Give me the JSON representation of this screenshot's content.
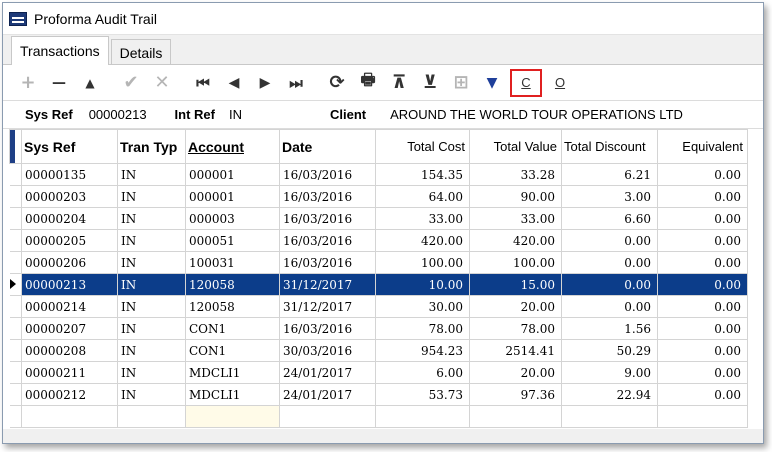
{
  "window": {
    "title": "Proforma Audit Trail"
  },
  "tabs": [
    {
      "label": "Transactions"
    },
    {
      "label": "Details"
    }
  ],
  "toolbar": {
    "buttons": [
      {
        "icon": "plus-icon",
        "glyph": "+"
      },
      {
        "icon": "minus-icon",
        "glyph": "—"
      },
      {
        "icon": "up-triangle-icon",
        "glyph": "▲"
      },
      {
        "icon": "checkmark-icon",
        "glyph": "✔"
      },
      {
        "icon": "cross-icon",
        "glyph": "✕"
      },
      {
        "icon": "first-record-icon",
        "glyph": "⏮"
      },
      {
        "icon": "prev-record-icon",
        "glyph": "◀"
      },
      {
        "icon": "next-record-icon",
        "glyph": "▶"
      },
      {
        "icon": "last-record-icon",
        "glyph": "⏭"
      },
      {
        "icon": "refresh-icon",
        "glyph": "⟳"
      },
      {
        "icon": "print-icon",
        "glyph": "🖶"
      },
      {
        "icon": "sort-top-icon",
        "glyph": "⊼"
      },
      {
        "icon": "sort-bottom-icon",
        "glyph": "⊻"
      },
      {
        "icon": "add-folder-icon",
        "glyph": "⊞"
      },
      {
        "icon": "filter-icon",
        "glyph": "▼"
      }
    ],
    "c_label": "C",
    "o_label": "O"
  },
  "info": {
    "sys_ref_label": "Sys Ref",
    "sys_ref_value": "00000213",
    "int_ref_label": "Int Ref",
    "int_ref_value": "IN",
    "client_label": "Client",
    "client_value": "AROUND THE WORLD TOUR OPERATIONS LTD"
  },
  "grid": {
    "headers": {
      "sys_ref": "Sys Ref",
      "tran_type": "Tran Typ",
      "account": "Account",
      "date": "Date",
      "total_cost": "Total Cost",
      "total_value": "Total Value",
      "total_discount": "Total Discount",
      "equivalent": "Equivalent"
    },
    "rows": [
      {
        "sys_ref": "00000135",
        "tran": "IN",
        "account": "000001",
        "date": "16/03/2016",
        "cost": "154.35",
        "value": "33.28",
        "discount": "6.21",
        "equiv": "0.00"
      },
      {
        "sys_ref": "00000203",
        "tran": "IN",
        "account": "000001",
        "date": "16/03/2016",
        "cost": "64.00",
        "value": "90.00",
        "discount": "3.00",
        "equiv": "0.00"
      },
      {
        "sys_ref": "00000204",
        "tran": "IN",
        "account": "000003",
        "date": "16/03/2016",
        "cost": "33.00",
        "value": "33.00",
        "discount": "6.60",
        "equiv": "0.00"
      },
      {
        "sys_ref": "00000205",
        "tran": "IN",
        "account": "000051",
        "date": "16/03/2016",
        "cost": "420.00",
        "value": "420.00",
        "discount": "0.00",
        "equiv": "0.00"
      },
      {
        "sys_ref": "00000206",
        "tran": "IN",
        "account": "100031",
        "date": "16/03/2016",
        "cost": "100.00",
        "value": "100.00",
        "discount": "0.00",
        "equiv": "0.00"
      },
      {
        "sys_ref": "00000213",
        "tran": "IN",
        "account": "120058",
        "date": "31/12/2017",
        "cost": "10.00",
        "value": "15.00",
        "discount": "0.00",
        "equiv": "0.00"
      },
      {
        "sys_ref": "00000214",
        "tran": "IN",
        "account": "120058",
        "date": "31/12/2017",
        "cost": "30.00",
        "value": "20.00",
        "discount": "0.00",
        "equiv": "0.00"
      },
      {
        "sys_ref": "00000207",
        "tran": "IN",
        "account": "CON1",
        "date": "16/03/2016",
        "cost": "78.00",
        "value": "78.00",
        "discount": "1.56",
        "equiv": "0.00"
      },
      {
        "sys_ref": "00000208",
        "tran": "IN",
        "account": "CON1",
        "date": "30/03/2016",
        "cost": "954.23",
        "value": "2514.41",
        "discount": "50.29",
        "equiv": "0.00"
      },
      {
        "sys_ref": "00000211",
        "tran": "IN",
        "account": "MDCLI1",
        "date": "24/01/2017",
        "cost": "6.00",
        "value": "20.00",
        "discount": "9.00",
        "equiv": "0.00"
      },
      {
        "sys_ref": "00000212",
        "tran": "IN",
        "account": "MDCLI1",
        "date": "24/01/2017",
        "cost": "53.73",
        "value": "97.36",
        "discount": "22.94",
        "equiv": "0.00"
      }
    ]
  },
  "colors": {
    "selection": "#0c3d8a",
    "highlight_border": "#e02020",
    "filter_icon": "#1f3f9a"
  }
}
